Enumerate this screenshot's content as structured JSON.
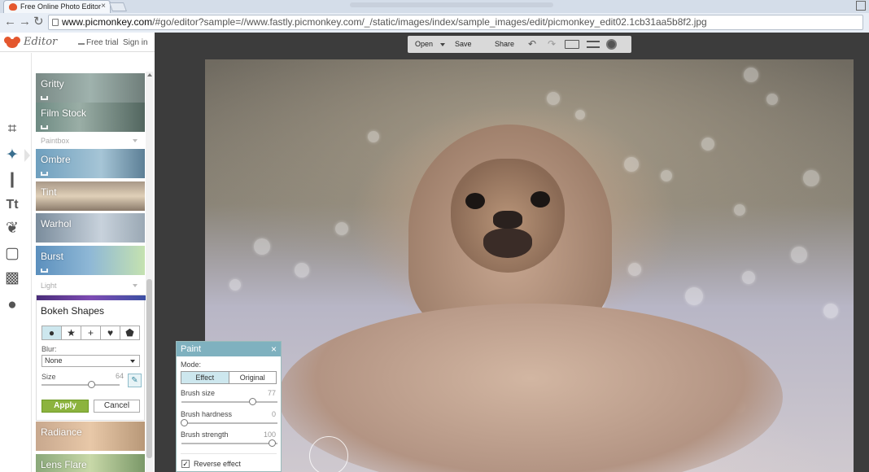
{
  "browser": {
    "tab_title": "Free Online Photo Editor",
    "tab_close": "×",
    "url_host": "www.picmonkey.com",
    "url_rest": "/#go/editor?sample=//www.fastly.picmonkey.com/_/static/images/index/sample_images/edit/picmonkey_edit02.1cb31aa5b8f2.jpg",
    "back": "←",
    "forward": "→",
    "reload": "↻"
  },
  "header": {
    "logo_text": "Editor",
    "free_trial": "Free trial",
    "sign_in": "Sign in"
  },
  "tools": [
    {
      "name": "crop-icon",
      "glyph": "⌗"
    },
    {
      "name": "effects-wand-icon",
      "glyph": "✦"
    },
    {
      "name": "touch-up-brush-icon",
      "glyph": "❙"
    },
    {
      "name": "text-icon",
      "glyph": "Tt"
    },
    {
      "name": "overlay-butterfly-icon",
      "glyph": "❦"
    },
    {
      "name": "frames-icon",
      "glyph": "▢"
    },
    {
      "name": "textures-icon",
      "glyph": "▩"
    },
    {
      "name": "themes-apple-icon",
      "glyph": "●"
    }
  ],
  "effects": {
    "tile_gritty": "Gritty",
    "tile_film_stock": "Film Stock",
    "section_paintbox": "Paintbox",
    "tile_ombre": "Ombre",
    "tile_tint": "Tint",
    "tile_warhol": "Warhol",
    "tile_burst": "Burst",
    "section_light": "Light",
    "tile_radiance": "Radiance",
    "tile_lens_flare": "Lens Flare"
  },
  "bokeh": {
    "title": "Bokeh Shapes",
    "shapes": [
      "●",
      "★",
      "+",
      "♥",
      "⬟"
    ],
    "blur_label": "Blur:",
    "blur_value": "None",
    "size_label": "Size",
    "size_value": "64",
    "size_fraction": 0.64,
    "brush_glyph": "✎",
    "apply": "Apply",
    "cancel": "Cancel"
  },
  "toolbar": {
    "open": "Open",
    "save": "Save",
    "share": "Share",
    "undo": "↶",
    "redo": "↷"
  },
  "paint": {
    "title": "Paint",
    "close": "×",
    "mode_label": "Mode:",
    "mode_effect": "Effect",
    "mode_original": "Original",
    "brush_size_label": "Brush size",
    "brush_size_value": "77",
    "brush_hardness_label": "Brush hardness",
    "brush_hardness_value": "0",
    "brush_strength_label": "Brush strength",
    "brush_strength_value": "100",
    "reverse_check": "✓",
    "reverse_label": "Reverse effect"
  },
  "colors": {
    "accent": "#7fb1bf",
    "apply_green": "#8cb33e",
    "logo_orange": "#e4572e",
    "canvas_bg": "#3c3c3c"
  }
}
